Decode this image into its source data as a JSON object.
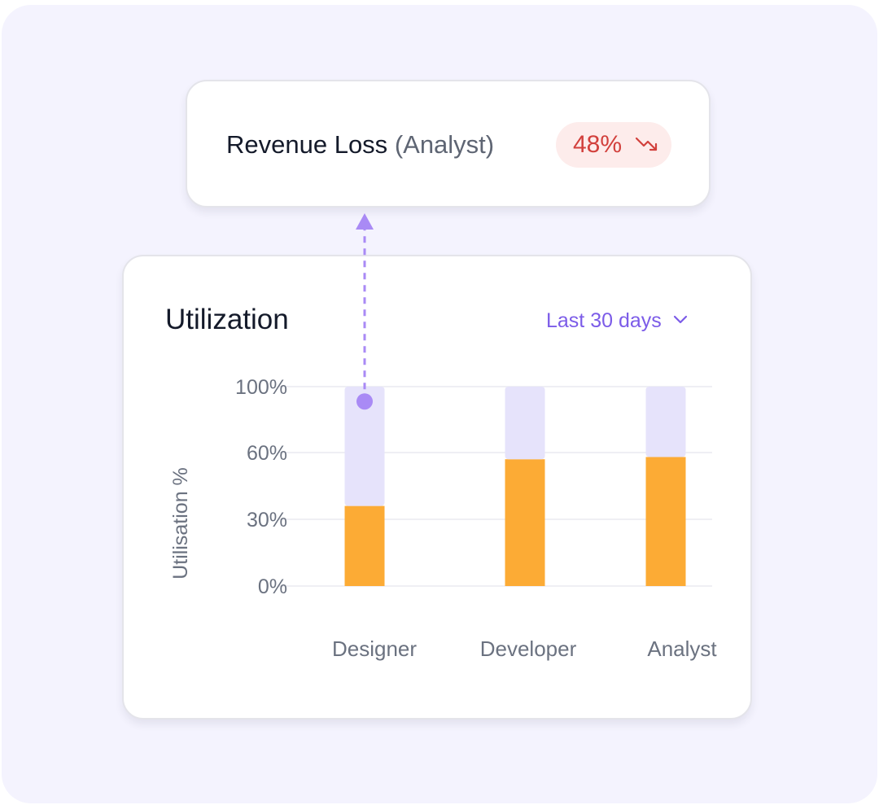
{
  "tooltip": {
    "metric": "Revenue Loss",
    "role": "(Analyst)",
    "delta": "48%",
    "delta_icon": "trend-down-icon",
    "delta_color": "#d2403c",
    "badge_bg": "#fdeceb"
  },
  "card": {
    "title": "Utilization",
    "range_label": "Last 30 days",
    "range_icon": "chevron-down-icon"
  },
  "chart_data": {
    "type": "bar",
    "stacked": true,
    "categories": [
      "Designer",
      "Developer",
      "Analyst"
    ],
    "series": [
      {
        "values": [
          36,
          57,
          58
        ],
        "color": "#fcab35"
      },
      {
        "values": [
          64,
          43,
          42
        ],
        "color": "#e6e3fb"
      }
    ],
    "ylabel": "Utilisation %",
    "xlabel": "",
    "yticks": [
      {
        "value": 0,
        "label": "0%"
      },
      {
        "value": 30,
        "label": "30%"
      },
      {
        "value": 60,
        "label": "60%"
      },
      {
        "value": 100,
        "label": "100%"
      }
    ],
    "ylim": [
      0,
      100
    ],
    "grid": true,
    "highlight": {
      "category": "Designer",
      "value": 91,
      "color": "#a98af5"
    }
  }
}
